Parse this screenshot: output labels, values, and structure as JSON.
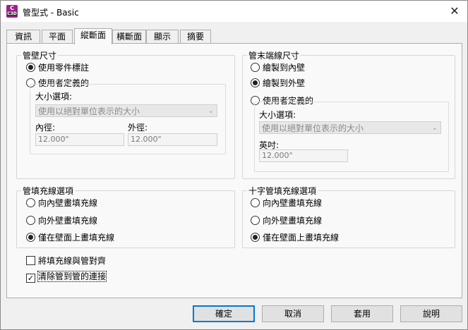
{
  "window": {
    "title": "管型式 - Basic",
    "icon_letter": "C",
    "icon_sub": "C3D",
    "close_glyph": "✕"
  },
  "tabs": [
    {
      "label": "資訊",
      "active": false
    },
    {
      "label": "平面",
      "active": false
    },
    {
      "label": "縱斷面",
      "active": true
    },
    {
      "label": "橫斷面",
      "active": false
    },
    {
      "label": "顯示",
      "active": false
    },
    {
      "label": "摘要",
      "active": false
    }
  ],
  "wall_size": {
    "title": "管壁尺寸",
    "options": [
      "使用零件標註",
      "使用者定義的"
    ],
    "selected": 0,
    "size_option_label": "大小選項:",
    "size_option_value": "使用以絕對單位表示的大小",
    "inner_label": "內徑:",
    "inner_value": "12.000\"",
    "outer_label": "外徑:",
    "outer_value": "12.000\""
  },
  "end_line_size": {
    "title": "管末端線尺寸",
    "options": [
      "繪製到內壁",
      "繪製到外壁",
      "使用者定義的"
    ],
    "selected": 1,
    "size_option_label": "大小選項:",
    "size_option_value": "使用以絕對單位表示的大小",
    "inch_label": "英吋:",
    "inch_value": "12.000\""
  },
  "hatch_options": {
    "title": "管填充線選項",
    "options": [
      "向內壁畫填充線",
      "向外壁畫填充線",
      "僅在壁面上畫填充線"
    ],
    "selected": 2
  },
  "cross_hatch_options": {
    "title": "十字管填充線選項",
    "options": [
      "向內壁畫填充線",
      "向外壁畫填充線",
      "僅在壁面上畫填充線"
    ],
    "selected": 2
  },
  "checkboxes": {
    "align_hatch": {
      "label": "將填充線與管對齊",
      "checked": false
    },
    "clean_connection": {
      "label": "清除管到管的連接",
      "checked": true
    }
  },
  "buttons": {
    "ok": "確定",
    "cancel": "取消",
    "apply": "套用",
    "help": "說明"
  }
}
